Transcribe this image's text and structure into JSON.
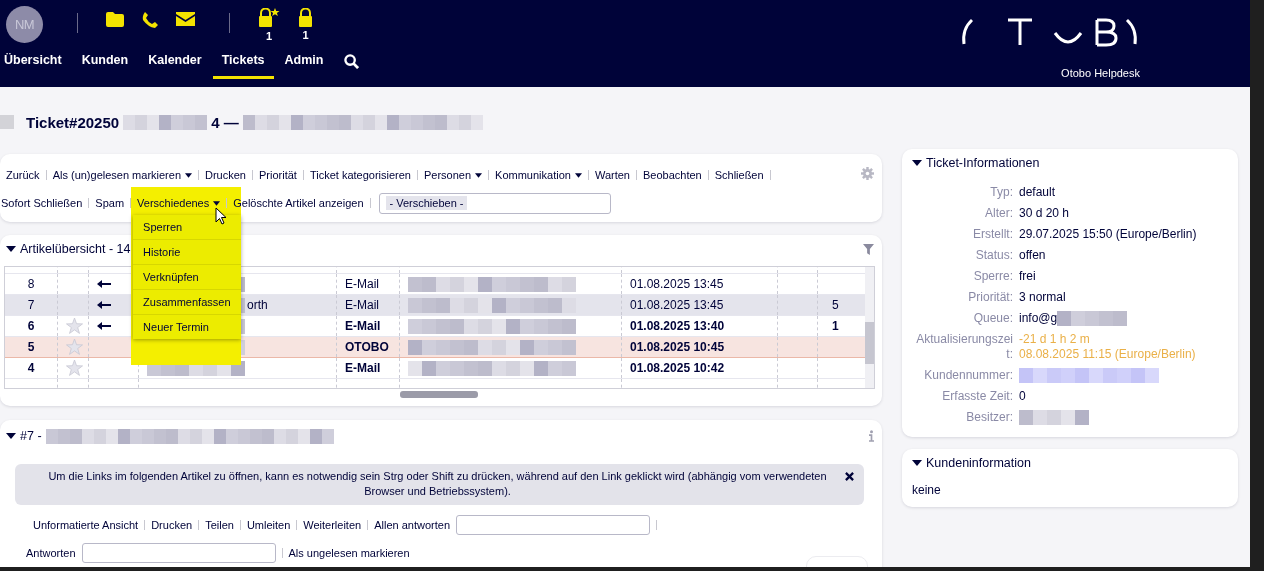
{
  "header": {
    "avatar": "NM",
    "lock_counts": [
      "1",
      "1"
    ],
    "nav": [
      {
        "label": "Übersicht",
        "selected": false
      },
      {
        "label": "Kunden",
        "selected": false
      },
      {
        "label": "Kalender",
        "selected": false
      },
      {
        "label": "Tickets",
        "selected": true
      },
      {
        "label": "Admin",
        "selected": false
      }
    ],
    "brand": "Otobo Helpdesk"
  },
  "ticket_title": {
    "number": "Ticket#20250",
    "suffix": "4 —"
  },
  "actions": {
    "row_1": [
      {
        "label": "Zurück",
        "dropdown": false
      },
      {
        "label": "Als (un)gelesen markieren",
        "dropdown": true
      },
      {
        "label": "Drucken",
        "dropdown": false
      },
      {
        "label": "Priorität",
        "dropdown": false
      },
      {
        "label": "Ticket kategorisieren",
        "dropdown": false
      },
      {
        "label": "Personen",
        "dropdown": true
      },
      {
        "label": "Kommunikation",
        "dropdown": true
      },
      {
        "label": "Warten",
        "dropdown": false
      },
      {
        "label": "Beobachten",
        "dropdown": false
      },
      {
        "label": "Schließen",
        "dropdown": false
      }
    ],
    "row_2": [
      {
        "label": "Sofort Schließen",
        "dropdown": false
      },
      {
        "label": "Spam",
        "dropdown": false
      },
      {
        "label": "Verschiedenes",
        "dropdown": true
      },
      {
        "label": "Gelöschte Artikel anzeigen",
        "dropdown": false
      }
    ],
    "move_select": "- Verschieben -",
    "open_menu": [
      "Sperren",
      "Historie",
      "Verknüpfen",
      "Zusammenfassen",
      "Neuer Termin"
    ]
  },
  "article_overview": {
    "title": "Artikelübersicht - 14",
    "rows": [
      {
        "number": "8",
        "star": false,
        "arrow": true,
        "type": "E-Mail",
        "date": "01.08.2025 13:45",
        "unread": false,
        "selected": false,
        "internal": false
      },
      {
        "number": "7",
        "star": false,
        "arrow": true,
        "sender": "orth",
        "type": "E-Mail",
        "date": "01.08.2025 13:45",
        "count": "5",
        "unread": false,
        "selected": true,
        "internal": false
      },
      {
        "number": "6",
        "star": true,
        "arrow": true,
        "type": "E-Mail",
        "date": "01.08.2025 13:40",
        "count": "1",
        "unread": true,
        "selected": false,
        "internal": false
      },
      {
        "number": "5",
        "star": true,
        "arrow": false,
        "type": "OTOBO",
        "date": "01.08.2025 10:45",
        "unread": true,
        "selected": false,
        "internal": true
      },
      {
        "number": "4",
        "star": true,
        "arrow": false,
        "type": "E-Mail",
        "date": "01.08.2025 10:42",
        "unread": true,
        "selected": false,
        "internal": false
      }
    ]
  },
  "article": {
    "title": "#7 -",
    "notice": "Um die Links im folgenden Artikel zu öffnen, kann es notwendig sein Strg oder Shift zu drücken, während auf den Link geklickt wird (abhängig vom verwendeten Browser und Betriebssystem).",
    "actions_1": [
      "Unformatierte Ansicht",
      "Drucken",
      "Teilen",
      "Umleiten",
      "Weiterleiten",
      "Allen antworten"
    ],
    "actions_2": [
      "Antworten",
      "Als ungelesen markieren"
    ]
  },
  "ticket_info": {
    "title": "Ticket-Informationen",
    "fields": [
      {
        "label": "Typ:",
        "value": "default",
        "kind": "plain"
      },
      {
        "label": "Alter:",
        "value": "30 d 20 h",
        "kind": "plain"
      },
      {
        "label": "Erstellt:",
        "value": "29.07.2025 15:50 (Europe/Berlin)",
        "kind": "plain"
      },
      {
        "label": "Status:",
        "value": "offen",
        "kind": "plain"
      },
      {
        "label": "Sperre:",
        "value": "frei",
        "kind": "plain"
      },
      {
        "label": "Priorität:",
        "value": "3 normal",
        "kind": "plain"
      },
      {
        "label": "Queue:",
        "value": "info@g",
        "kind": "redacted"
      },
      {
        "label": "Aktualisierungszeit:",
        "value": "-21 d 1 h 2 m",
        "value_2": "08.08.2025 11:15 (Europe/Berlin)",
        "kind": "warning"
      },
      {
        "label": "Kundennummer:",
        "kind": "redacted-link"
      },
      {
        "label": "Erfasste Zeit:",
        "value": "0",
        "kind": "plain"
      },
      {
        "label": "Besitzer:",
        "kind": "redacted"
      }
    ]
  },
  "customer_info": {
    "title": "Kundeninformation",
    "value": "keine"
  }
}
